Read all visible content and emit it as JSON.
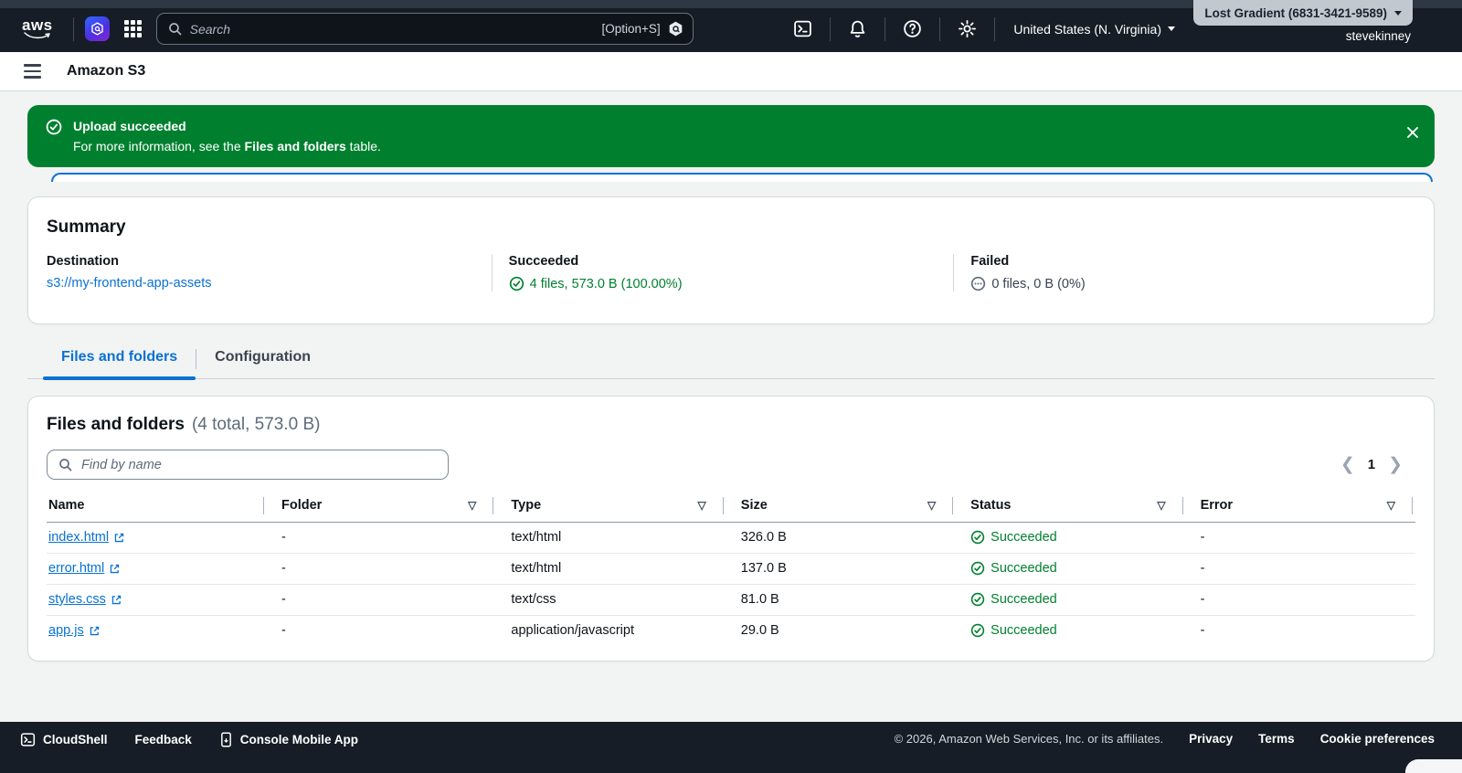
{
  "topnav": {
    "logo_text": "aws",
    "search_placeholder": "Search",
    "search_shortcut": "[Option+S]",
    "region": "United States (N. Virginia)",
    "account": "Lost Gradient (6831-3421-9589)",
    "username": "stevekinney"
  },
  "header": {
    "app_title": "Amazon S3"
  },
  "banner": {
    "title": "Upload succeeded",
    "message_prefix": "For more information, see the ",
    "message_bold": "Files and folders",
    "message_suffix": " table."
  },
  "summary": {
    "title": "Summary",
    "destination_label": "Destination",
    "destination_value": "s3://my-frontend-app-assets",
    "succeeded_label": "Succeeded",
    "succeeded_value": "4 files, 573.0 B (100.00%)",
    "failed_label": "Failed",
    "failed_value": "0 files, 0 B (0%)"
  },
  "tabs": [
    {
      "label": "Files and folders",
      "active": true
    },
    {
      "label": "Configuration",
      "active": false
    }
  ],
  "files_panel": {
    "title": "Files and folders",
    "subtitle": "(4 total, 573.0 B)",
    "search_placeholder": "Find by name",
    "page": "1"
  },
  "table": {
    "columns": [
      {
        "label": "Name",
        "filterable": false
      },
      {
        "label": "Folder",
        "filterable": true
      },
      {
        "label": "Type",
        "filterable": true
      },
      {
        "label": "Size",
        "filterable": true
      },
      {
        "label": "Status",
        "filterable": true
      },
      {
        "label": "Error",
        "filterable": true
      }
    ],
    "rows": [
      {
        "name": "index.html",
        "folder": "-",
        "type": "text/html",
        "size": "326.0 B",
        "status": "Succeeded",
        "error": "-"
      },
      {
        "name": "error.html",
        "folder": "-",
        "type": "text/html",
        "size": "137.0 B",
        "status": "Succeeded",
        "error": "-"
      },
      {
        "name": "styles.css",
        "folder": "-",
        "type": "text/css",
        "size": "81.0 B",
        "status": "Succeeded",
        "error": "-"
      },
      {
        "name": "app.js",
        "folder": "-",
        "type": "application/javascript",
        "size": "29.0 B",
        "status": "Succeeded",
        "error": "-"
      }
    ]
  },
  "footer": {
    "cloudshell": "CloudShell",
    "feedback": "Feedback",
    "mobile_app": "Console Mobile App",
    "copyright": "© 2026, Amazon Web Services, Inc. or its affiliates.",
    "privacy": "Privacy",
    "terms": "Terms",
    "cookies": "Cookie preferences"
  },
  "colors": {
    "accent": "#0972d3",
    "success_green": "#00802f",
    "topbar_dark": "#161d26"
  }
}
